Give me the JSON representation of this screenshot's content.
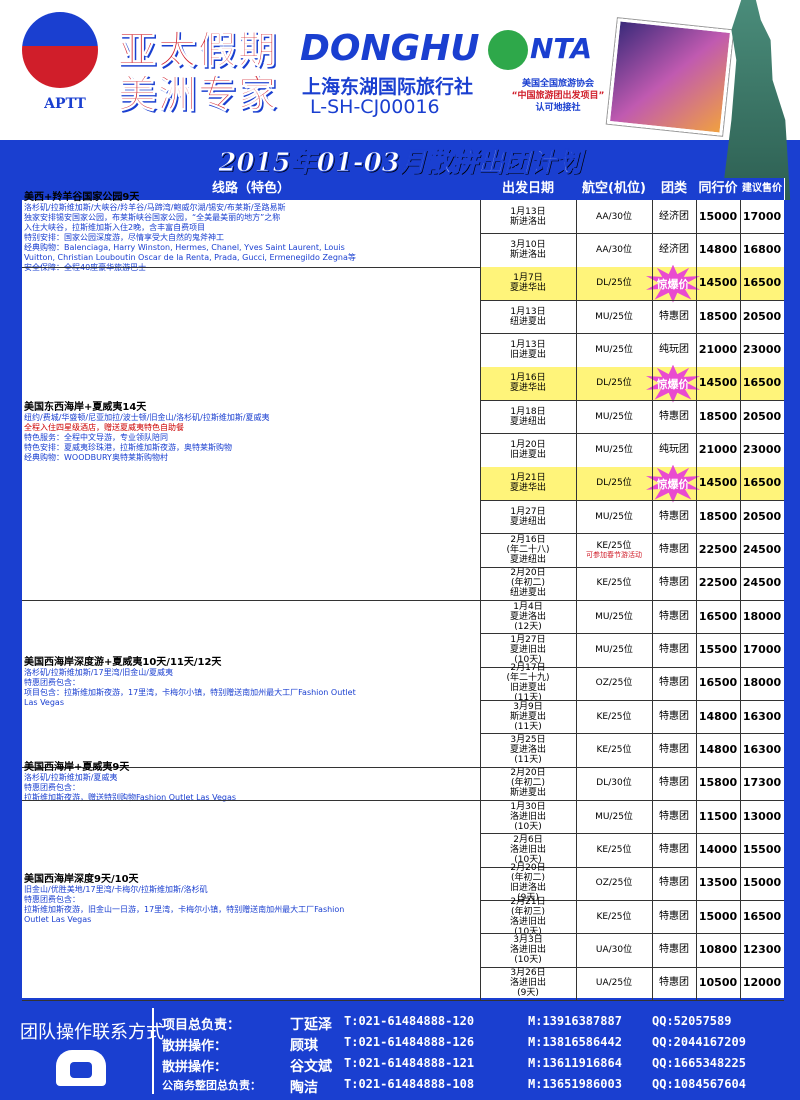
{
  "header": {
    "logo_text": "APTT",
    "brand_line1": "亚太假期",
    "brand_line2": "美洲专家",
    "donghu_en": "DONGHU",
    "donghu_cn": "上海东湖国际旅行社",
    "license": "L-SH-CJ00016",
    "nta_logo": "NTA",
    "nta_line1": "美国全国旅游协会",
    "nta_line2": "“中国旅游团出发项目”",
    "nta_line3": "认可地接社"
  },
  "title": "2015年01-03月散拼出团计划",
  "columns": {
    "route": "线路（特色）",
    "date": "出发日期",
    "air": "航空(机位)",
    "type": "团类",
    "peer": "同行价",
    "retail": "建议售价"
  },
  "burst_label": "惊爆价",
  "routes": [
    {
      "title": "美西+羚羊谷国家公园9天",
      "desc": [
        "洛杉矶/拉斯维加斯/大峡谷/羚羊谷/马蹄湾/鲍威尔湖/锡安/布莱斯/圣路易斯",
        "独家安排锡安国家公园，布莱斯峡谷国家公园，“全美最美丽的地方”之称",
        "入住大峡谷，拉斯维加斯入住2晚，含丰富自费项目",
        "特别安排：国家公园深度游，尽情享受大自然的鬼斧神工",
        "经典购物：Balenciaga, Harry Winston, Hermes, Chanel, Yves Saint Laurent, Louis",
        "Vuitton, Christian Louboutin Oscar de la Renta, Prada, Gucci, Ermenegildo Zegna等",
        "安全保障：全程40座豪华旅游巴士"
      ],
      "rows": [
        {
          "date": [
            "1月13日",
            "斯进洛出"
          ],
          "air": "AA/30位",
          "type": "经济团",
          "peer": "15000",
          "retail": "17000"
        },
        {
          "date": [
            "3月10日",
            "斯进洛出"
          ],
          "air": "AA/30位",
          "type": "经济团",
          "peer": "14800",
          "retail": "16800"
        }
      ]
    },
    {
      "title": "美国东西海岸+夏威夷14天",
      "desc": [
        "纽约/费城/华盛顿/尼亚加拉/波士顿/旧金山/洛杉矶/拉斯维加斯/夏威夷",
        "全程入住四星级酒店，赠送夏威夷特色自助餐",
        "特色服务：全程中文导游，专业领队陪同",
        "特色安排：夏威夷珍珠港，拉斯维加斯夜游，奥特莱斯购物",
        "经典购物：WOODBURY奥特莱斯购物村"
      ],
      "rows": [
        {
          "date": [
            "1月7日",
            "夏进华出"
          ],
          "air": "DL/25位",
          "type": "惊爆价",
          "peer": "14500",
          "retail": "16500",
          "hl": true
        },
        {
          "date": [
            "1月13日",
            "纽进夏出"
          ],
          "air": "MU/25位",
          "type": "特惠团",
          "peer": "18500",
          "retail": "20500"
        },
        {
          "date": [
            "1月13日",
            "旧进夏出"
          ],
          "air": "MU/25位",
          "type": "纯玩团",
          "peer": "21000",
          "retail": "23000"
        },
        {
          "date": [
            "1月16日",
            "夏进华出"
          ],
          "air": "DL/25位",
          "type": "惊爆价",
          "peer": "14500",
          "retail": "16500",
          "hl": true
        },
        {
          "date": [
            "1月18日",
            "夏进纽出"
          ],
          "air": "MU/25位",
          "type": "特惠团",
          "peer": "18500",
          "retail": "20500"
        },
        {
          "date": [
            "1月20日",
            "旧进夏出"
          ],
          "air": "MU/25位",
          "type": "纯玩团",
          "peer": "21000",
          "retail": "23000"
        },
        {
          "date": [
            "1月21日",
            "夏进华出"
          ],
          "air": "DL/25位",
          "type": "惊爆价",
          "peer": "14500",
          "retail": "16500",
          "hl": true
        },
        {
          "date": [
            "1月27日",
            "夏进纽出"
          ],
          "air": "MU/25位",
          "type": "特惠团",
          "peer": "18500",
          "retail": "20500"
        },
        {
          "date": [
            "2月16日",
            "(年二十八)",
            "夏进纽出"
          ],
          "air": "KE/25位",
          "type": "特惠团",
          "peer": "22500",
          "retail": "24500",
          "note": "可参加春节游活动"
        },
        {
          "date": [
            "2月20日",
            "(年初二)",
            "纽进夏出"
          ],
          "air": "KE/25位",
          "type": "特惠团",
          "peer": "22500",
          "retail": "24500"
        }
      ]
    },
    {
      "title": "美国西海岸深度游+夏威夷10天/11天/12天",
      "desc": [
        "洛杉矶/拉斯维加斯/17里湾/旧金山/夏威夷",
        "特惠团费包含：",
        "项目包含：拉斯维加斯夜游，17里湾，卡梅尔小镇，特别赠送南加州最大工厂Fashion Outlet",
        "Las Vegas"
      ],
      "rows": [
        {
          "date": [
            "1月4日",
            "夏进洛出",
            "(12天)"
          ],
          "air": "MU/25位",
          "type": "特惠团",
          "peer": "16500",
          "retail": "18000"
        },
        {
          "date": [
            "1月27日",
            "夏进旧出",
            "(10天)"
          ],
          "air": "MU/25位",
          "type": "特惠团",
          "peer": "15500",
          "retail": "17000"
        },
        {
          "date": [
            "2月17日",
            "(年二十九)",
            "旧进夏出",
            "(11天)"
          ],
          "air": "OZ/25位",
          "type": "特惠团",
          "peer": "16500",
          "retail": "18000"
        },
        {
          "date": [
            "3月9日",
            "斯进夏出",
            "(11天)"
          ],
          "air": "KE/25位",
          "type": "特惠团",
          "peer": "14800",
          "retail": "16300"
        },
        {
          "date": [
            "3月25日",
            "夏进洛出",
            "(11天)"
          ],
          "air": "KE/25位",
          "type": "特惠团",
          "peer": "14800",
          "retail": "16300"
        }
      ]
    },
    {
      "title": "美国西海岸+夏威夷9天",
      "desc": [
        "洛杉矶/拉斯维加斯/夏威夷",
        "特惠团费包含：",
        "拉斯维加斯夜游，赠送特别购物Fashion Outlet Las Vegas"
      ],
      "rows": [
        {
          "date": [
            "2月20日",
            "(年初二)",
            "斯进夏出"
          ],
          "air": "DL/30位",
          "type": "特惠团",
          "peer": "15800",
          "retail": "17300"
        }
      ]
    },
    {
      "title": "美国西海岸深度9天/10天",
      "desc": [
        "旧金山/优胜美地/17里湾/卡梅尔/拉斯维加斯/洛杉矶",
        "特惠团费包含：",
        "拉斯维加斯夜游，旧金山一日游，17里湾，卡梅尔小镇，特别赠送南加州最大工厂Fashion",
        "Outlet Las Vegas"
      ],
      "rows": [
        {
          "date": [
            "1月30日",
            "洛进旧出",
            "(10天)"
          ],
          "air": "MU/25位",
          "type": "特惠团",
          "peer": "11500",
          "retail": "13000"
        },
        {
          "date": [
            "2月6日",
            "洛进旧出",
            "(10天)"
          ],
          "air": "KE/25位",
          "type": "特惠团",
          "peer": "14000",
          "retail": "15500"
        },
        {
          "date": [
            "2月20日",
            "(年初二)",
            "旧进洛出",
            "(9天)"
          ],
          "air": "OZ/25位",
          "type": "特惠团",
          "peer": "13500",
          "retail": "15000"
        },
        {
          "date": [
            "2月21日",
            "(年初三)",
            "洛进旧出",
            "(10天)"
          ],
          "air": "KE/25位",
          "type": "特惠团",
          "peer": "15000",
          "retail": "16500"
        },
        {
          "date": [
            "3月3日",
            "洛进旧出",
            "(10天)"
          ],
          "air": "UA/30位",
          "type": "特惠团",
          "peer": "10800",
          "retail": "12300"
        },
        {
          "date": [
            "3月26日",
            "洛进旧出",
            "(9天)"
          ],
          "air": "UA/25位",
          "type": "特惠团",
          "peer": "10500",
          "retail": "12000"
        }
      ]
    }
  ],
  "footer": {
    "contact_title": "团队操作联系方式",
    "contacts": [
      {
        "role": "项目总负责：",
        "name": "丁延泽",
        "tel": "T:021-61484888-120",
        "mobile": "M:13916387887",
        "qq": "QQ:52057589"
      },
      {
        "role": "散拼操作：",
        "name": "顾琪",
        "tel": "T:021-61484888-126",
        "mobile": "M:13816586442",
        "qq": "QQ:2044167209"
      },
      {
        "role": "散拼操作：",
        "name": "谷文斌",
        "tel": "T:021-61484888-121",
        "mobile": "M:13611916864",
        "qq": "QQ:1665348225"
      },
      {
        "role": "公商务整团总负责：",
        "name": "陶洁",
        "tel": "T:021-61484888-108",
        "mobile": "M:13651986003",
        "qq": "QQ:1084567604"
      }
    ]
  }
}
